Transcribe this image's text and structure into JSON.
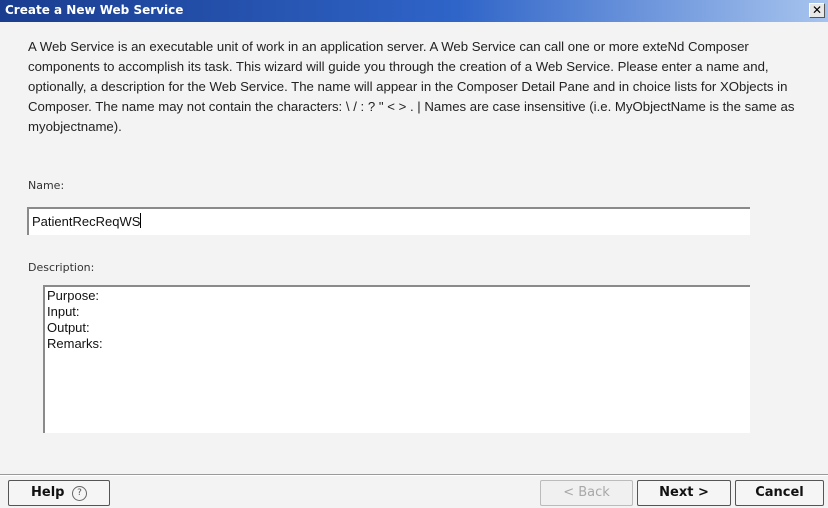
{
  "window": {
    "title": "Create a New Web Service",
    "close_glyph": "✕"
  },
  "intro_text": "A Web Service is an executable unit of work in an application server.  A Web Service can call one or more exteNd Composer components to accomplish its task.  This wizard will guide you through the creation of a Web Service.  Please enter a name and, optionally, a description for the Web Service.  The name will appear in the Composer Detail Pane and in choice lists for XObjects in Composer.  The name may not contain the characters: \\ / : ? \" < > . |  Names are case insensitive (i.e. MyObjectName is the same as myobjectname).",
  "name_field": {
    "label": "Name:",
    "value": "PatientRecReqWS"
  },
  "description_field": {
    "label": "Description:",
    "lines": [
      "Purpose:",
      "Input:",
      "Output:",
      "Remarks:"
    ]
  },
  "buttons": {
    "help": "Help",
    "help_icon_glyph": "?",
    "back": "< Back",
    "next": "Next >",
    "cancel": "Cancel"
  },
  "icons": {
    "close": "close-icon",
    "help": "help-circle-icon"
  }
}
